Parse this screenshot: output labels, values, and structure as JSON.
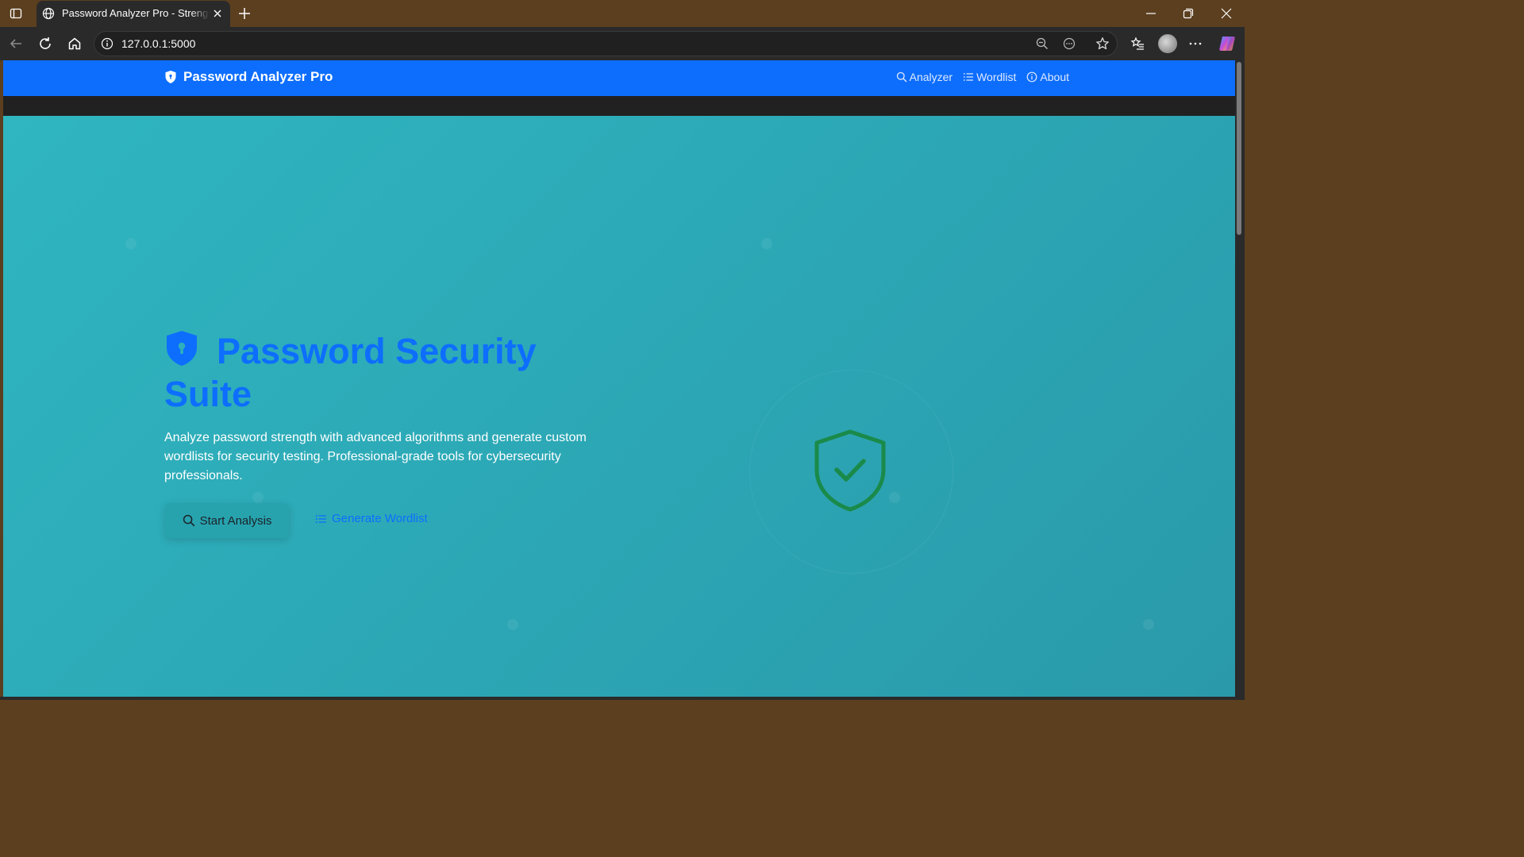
{
  "browser": {
    "tab_title": "Password Analyzer Pro - Strength",
    "url": "127.0.0.1:5000",
    "colors": {
      "frame": "#5b3f1f",
      "toolbar": "#2a2a2a"
    }
  },
  "site": {
    "brand": "Password Analyzer Pro",
    "nav": [
      {
        "label": "Analyzer",
        "icon": "search-icon"
      },
      {
        "label": "Wordlist",
        "icon": "list-icon"
      },
      {
        "label": "About",
        "icon": "info-icon"
      }
    ],
    "hero": {
      "title": "Password Security Suite",
      "description": "Analyze password strength with advanced algorithms and generate custom wordlists for security testing. Professional-grade tools for cybersecurity professionals.",
      "primary_button": "Start Analysis",
      "secondary_button": "Generate Wordlist"
    },
    "colors": {
      "primary": "#0d6efd",
      "hero": "#2aaab8",
      "shield": "#1a8a4a"
    }
  }
}
